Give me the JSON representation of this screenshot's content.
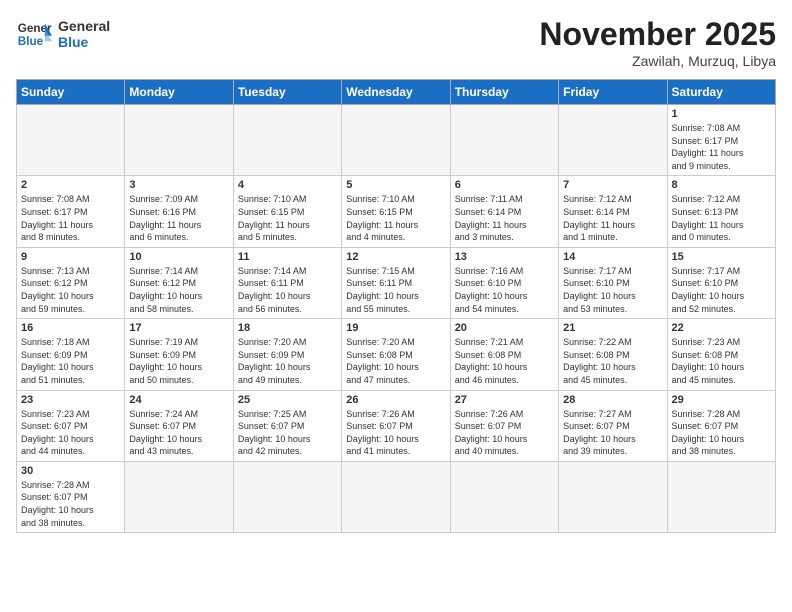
{
  "header": {
    "logo_general": "General",
    "logo_blue": "Blue",
    "month": "November 2025",
    "location": "Zawilah, Murzuq, Libya"
  },
  "weekdays": [
    "Sunday",
    "Monday",
    "Tuesday",
    "Wednesday",
    "Thursday",
    "Friday",
    "Saturday"
  ],
  "weeks": [
    [
      {
        "day": "",
        "info": ""
      },
      {
        "day": "",
        "info": ""
      },
      {
        "day": "",
        "info": ""
      },
      {
        "day": "",
        "info": ""
      },
      {
        "day": "",
        "info": ""
      },
      {
        "day": "",
        "info": ""
      },
      {
        "day": "1",
        "info": "Sunrise: 7:08 AM\nSunset: 6:17 PM\nDaylight: 11 hours\nand 9 minutes."
      }
    ],
    [
      {
        "day": "2",
        "info": "Sunrise: 7:08 AM\nSunset: 6:17 PM\nDaylight: 11 hours\nand 8 minutes."
      },
      {
        "day": "3",
        "info": "Sunrise: 7:09 AM\nSunset: 6:16 PM\nDaylight: 11 hours\nand 6 minutes."
      },
      {
        "day": "4",
        "info": "Sunrise: 7:10 AM\nSunset: 6:15 PM\nDaylight: 11 hours\nand 5 minutes."
      },
      {
        "day": "5",
        "info": "Sunrise: 7:10 AM\nSunset: 6:15 PM\nDaylight: 11 hours\nand 4 minutes."
      },
      {
        "day": "6",
        "info": "Sunrise: 7:11 AM\nSunset: 6:14 PM\nDaylight: 11 hours\nand 3 minutes."
      },
      {
        "day": "7",
        "info": "Sunrise: 7:12 AM\nSunset: 6:14 PM\nDaylight: 11 hours\nand 1 minute."
      },
      {
        "day": "8",
        "info": "Sunrise: 7:12 AM\nSunset: 6:13 PM\nDaylight: 11 hours\nand 0 minutes."
      }
    ],
    [
      {
        "day": "9",
        "info": "Sunrise: 7:13 AM\nSunset: 6:12 PM\nDaylight: 10 hours\nand 59 minutes."
      },
      {
        "day": "10",
        "info": "Sunrise: 7:14 AM\nSunset: 6:12 PM\nDaylight: 10 hours\nand 58 minutes."
      },
      {
        "day": "11",
        "info": "Sunrise: 7:14 AM\nSunset: 6:11 PM\nDaylight: 10 hours\nand 56 minutes."
      },
      {
        "day": "12",
        "info": "Sunrise: 7:15 AM\nSunset: 6:11 PM\nDaylight: 10 hours\nand 55 minutes."
      },
      {
        "day": "13",
        "info": "Sunrise: 7:16 AM\nSunset: 6:10 PM\nDaylight: 10 hours\nand 54 minutes."
      },
      {
        "day": "14",
        "info": "Sunrise: 7:17 AM\nSunset: 6:10 PM\nDaylight: 10 hours\nand 53 minutes."
      },
      {
        "day": "15",
        "info": "Sunrise: 7:17 AM\nSunset: 6:10 PM\nDaylight: 10 hours\nand 52 minutes."
      }
    ],
    [
      {
        "day": "16",
        "info": "Sunrise: 7:18 AM\nSunset: 6:09 PM\nDaylight: 10 hours\nand 51 minutes."
      },
      {
        "day": "17",
        "info": "Sunrise: 7:19 AM\nSunset: 6:09 PM\nDaylight: 10 hours\nand 50 minutes."
      },
      {
        "day": "18",
        "info": "Sunrise: 7:20 AM\nSunset: 6:09 PM\nDaylight: 10 hours\nand 49 minutes."
      },
      {
        "day": "19",
        "info": "Sunrise: 7:20 AM\nSunset: 6:08 PM\nDaylight: 10 hours\nand 47 minutes."
      },
      {
        "day": "20",
        "info": "Sunrise: 7:21 AM\nSunset: 6:08 PM\nDaylight: 10 hours\nand 46 minutes."
      },
      {
        "day": "21",
        "info": "Sunrise: 7:22 AM\nSunset: 6:08 PM\nDaylight: 10 hours\nand 45 minutes."
      },
      {
        "day": "22",
        "info": "Sunrise: 7:23 AM\nSunset: 6:08 PM\nDaylight: 10 hours\nand 45 minutes."
      }
    ],
    [
      {
        "day": "23",
        "info": "Sunrise: 7:23 AM\nSunset: 6:07 PM\nDaylight: 10 hours\nand 44 minutes."
      },
      {
        "day": "24",
        "info": "Sunrise: 7:24 AM\nSunset: 6:07 PM\nDaylight: 10 hours\nand 43 minutes."
      },
      {
        "day": "25",
        "info": "Sunrise: 7:25 AM\nSunset: 6:07 PM\nDaylight: 10 hours\nand 42 minutes."
      },
      {
        "day": "26",
        "info": "Sunrise: 7:26 AM\nSunset: 6:07 PM\nDaylight: 10 hours\nand 41 minutes."
      },
      {
        "day": "27",
        "info": "Sunrise: 7:26 AM\nSunset: 6:07 PM\nDaylight: 10 hours\nand 40 minutes."
      },
      {
        "day": "28",
        "info": "Sunrise: 7:27 AM\nSunset: 6:07 PM\nDaylight: 10 hours\nand 39 minutes."
      },
      {
        "day": "29",
        "info": "Sunrise: 7:28 AM\nSunset: 6:07 PM\nDaylight: 10 hours\nand 38 minutes."
      }
    ],
    [
      {
        "day": "30",
        "info": "Sunrise: 7:28 AM\nSunset: 6:07 PM\nDaylight: 10 hours\nand 38 minutes."
      },
      {
        "day": "",
        "info": ""
      },
      {
        "day": "",
        "info": ""
      },
      {
        "day": "",
        "info": ""
      },
      {
        "day": "",
        "info": ""
      },
      {
        "day": "",
        "info": ""
      },
      {
        "day": "",
        "info": ""
      }
    ]
  ]
}
